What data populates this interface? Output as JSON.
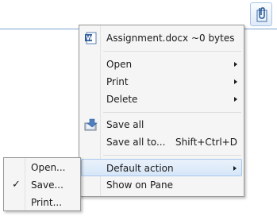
{
  "menu": {
    "attachment_label": "Assignment.docx ~0 bytes",
    "items": [
      {
        "label": "Open"
      },
      {
        "label": "Print"
      },
      {
        "label": "Delete"
      },
      {
        "label": "Save all"
      },
      {
        "label": "Save all to...",
        "shortcut": "Shift+Ctrl+D"
      },
      {
        "label": "Default action"
      },
      {
        "label": "Show on Pane"
      }
    ]
  },
  "submenu": {
    "items": [
      {
        "label": "Open..."
      },
      {
        "label": "Save...",
        "checked": true,
        "check": "✓"
      },
      {
        "label": "Print..."
      }
    ]
  }
}
